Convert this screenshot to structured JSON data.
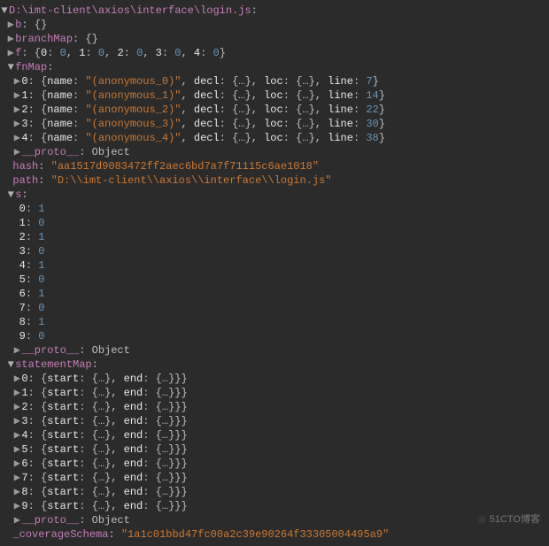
{
  "rootPath": "D:\\imt-client\\axios\\interface\\login.js",
  "b_label": "b",
  "b_val": "{}",
  "branchMap_label": "branchMap",
  "branchMap_val": "{}",
  "f_label": "f",
  "f_entries": [
    {
      "k": "0",
      "v": "0"
    },
    {
      "k": "1",
      "v": "0"
    },
    {
      "k": "2",
      "v": "0"
    },
    {
      "k": "3",
      "v": "0"
    },
    {
      "k": "4",
      "v": "0"
    }
  ],
  "fnMap_label": "fnMap",
  "fnMap": [
    {
      "idx": "0",
      "name": "(anonymous_0)",
      "decl": "{…}",
      "loc": "{…}",
      "line": "7"
    },
    {
      "idx": "1",
      "name": "(anonymous_1)",
      "decl": "{…}",
      "loc": "{…}",
      "line": "14"
    },
    {
      "idx": "2",
      "name": "(anonymous_2)",
      "decl": "{…}",
      "loc": "{…}",
      "line": "22"
    },
    {
      "idx": "3",
      "name": "(anonymous_3)",
      "decl": "{…}",
      "loc": "{…}",
      "line": "30"
    },
    {
      "idx": "4",
      "name": "(anonymous_4)",
      "decl": "{…}",
      "loc": "{…}",
      "line": "38"
    }
  ],
  "proto_label": "__proto__",
  "proto_val": "Object",
  "hash_label": "hash",
  "hash_val": "aa1517d9083472ff2aec6bd7a7f71115c6ae1018",
  "path_label": "path",
  "path_val": "D:\\\\imt-client\\\\axios\\\\interface\\\\login.js",
  "s_label": "s",
  "s": [
    {
      "k": "0",
      "v": "1"
    },
    {
      "k": "1",
      "v": "0"
    },
    {
      "k": "2",
      "v": "1"
    },
    {
      "k": "3",
      "v": "0"
    },
    {
      "k": "4",
      "v": "1"
    },
    {
      "k": "5",
      "v": "0"
    },
    {
      "k": "6",
      "v": "1"
    },
    {
      "k": "7",
      "v": "0"
    },
    {
      "k": "8",
      "v": "1"
    },
    {
      "k": "9",
      "v": "0"
    }
  ],
  "statementMap_label": "statementMap",
  "statementMap": [
    {
      "k": "0",
      "start": "{…}",
      "end": "{…}"
    },
    {
      "k": "1",
      "start": "{…}",
      "end": "{…}"
    },
    {
      "k": "2",
      "start": "{…}",
      "end": "{…}"
    },
    {
      "k": "3",
      "start": "{…}",
      "end": "{…}"
    },
    {
      "k": "4",
      "start": "{…}",
      "end": "{…}"
    },
    {
      "k": "5",
      "start": "{…}",
      "end": "{…}"
    },
    {
      "k": "6",
      "start": "{…}",
      "end": "{…}"
    },
    {
      "k": "7",
      "start": "{…}",
      "end": "{…}"
    },
    {
      "k": "8",
      "start": "{…}",
      "end": "{…}"
    },
    {
      "k": "9",
      "start": "{…}",
      "end": "{…}"
    }
  ],
  "coverageSchema_label": "_coverageSchema",
  "coverageSchema_val": "1a1c01bbd47fc00a2c39e90264f33305004495a9",
  "labels": {
    "name": "name",
    "decl": "decl",
    "loc": "loc",
    "line": "line",
    "start": "start",
    "end": "end"
  },
  "watermark": "51CTO博客"
}
